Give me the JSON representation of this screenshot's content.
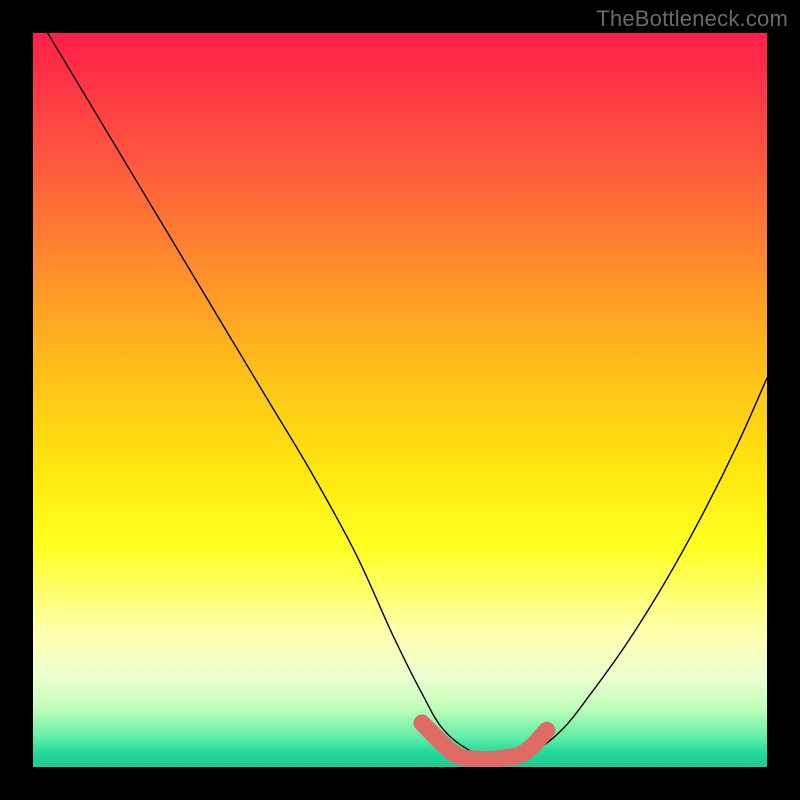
{
  "watermark": "TheBottleneck.com",
  "colors": {
    "background": "#000000",
    "gradient_top": "#ff1f49",
    "gradient_mid": "#ffe80f",
    "gradient_bottom": "#1ec98f",
    "curve": "#000000",
    "highlight": "#e06a64"
  },
  "chart_data": {
    "type": "line",
    "title": "",
    "xlabel": "",
    "ylabel": "",
    "xlim": [
      0,
      100
    ],
    "ylim": [
      0,
      100
    ],
    "grid": false,
    "series": [
      {
        "name": "bottleneck-curve",
        "x": [
          2,
          8,
          14,
          20,
          26,
          32,
          38,
          44,
          49,
          53,
          56,
          60,
          64,
          68,
          72,
          76,
          81,
          86,
          91,
          96,
          100
        ],
        "values": [
          100,
          90,
          80,
          70,
          60,
          50,
          40,
          29,
          18,
          10,
          5,
          2,
          1,
          2,
          5,
          10,
          17,
          25,
          34,
          44,
          53
        ]
      }
    ],
    "annotations": [
      {
        "name": "optimal-flat-region",
        "x": [
          53,
          56,
          58,
          61,
          64,
          67,
          70
        ],
        "values": [
          6,
          3,
          1.5,
          1,
          1.2,
          2,
          5
        ]
      }
    ]
  }
}
